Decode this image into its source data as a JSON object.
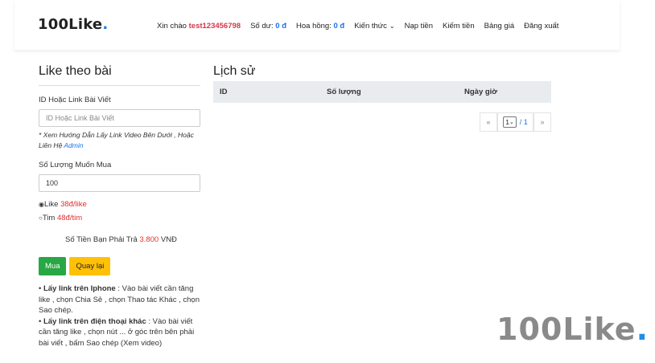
{
  "brand": {
    "text": "100Like",
    "dot": "."
  },
  "nav": {
    "greeting": "Xin chào",
    "username": "test123456798",
    "balance_label": "Số dư:",
    "balance_value": "0 đ",
    "commission_label": "Hoa hồng:",
    "commission_value": "0 đ",
    "knowledge": "Kiến thức",
    "deposit": "Nạp tiền",
    "earn": "Kiếm tiền",
    "pricing": "Bảng giá",
    "logout": "Đăng xuất"
  },
  "form": {
    "title": "Like theo bài",
    "id_label": "ID Hoặc Link Bài Viết",
    "id_placeholder": "ID Hoặc Link Bài Viết",
    "hint_text": "* Xem Hướng Dẫn Lấy Link Video Bên Dưới , Hoặc Liên Hệ",
    "hint_link": "Admin",
    "qty_label": "Số Lượng Muốn Mua",
    "qty_value": "100",
    "option_like_label": "Like",
    "option_like_price": "38đ/like",
    "option_heart_label": "Tim",
    "option_heart_price": "48đ/tim",
    "total_label": "Số Tiền Bạn Phải Trả",
    "total_value": "3.800",
    "total_unit": "VNĐ",
    "buy_label": "Mua",
    "back_label": "Quay lại",
    "guide_iphone_title": "Lấy link trên Iphone",
    "guide_iphone_text": ": Vào bài viết cần tăng like , chọn Chia Sẻ , chọn Thao tác Khác , chọn Sao chép.",
    "guide_other_title": "Lấy link trên điện thoại khác",
    "guide_other_text": ": Vào bài viết cần tăng like , chọn nút ... ở góc trên bên phải bài viết , bấm Sao chép (Xem video)"
  },
  "history": {
    "title": "Lịch sử",
    "columns": [
      "ID",
      "Số lượng",
      "Ngày giờ"
    ],
    "pager": {
      "prev": "«",
      "page": "1",
      "total": "/ 1",
      "next": "»"
    }
  },
  "watermark": {
    "text": "100Like",
    "dot": "."
  }
}
